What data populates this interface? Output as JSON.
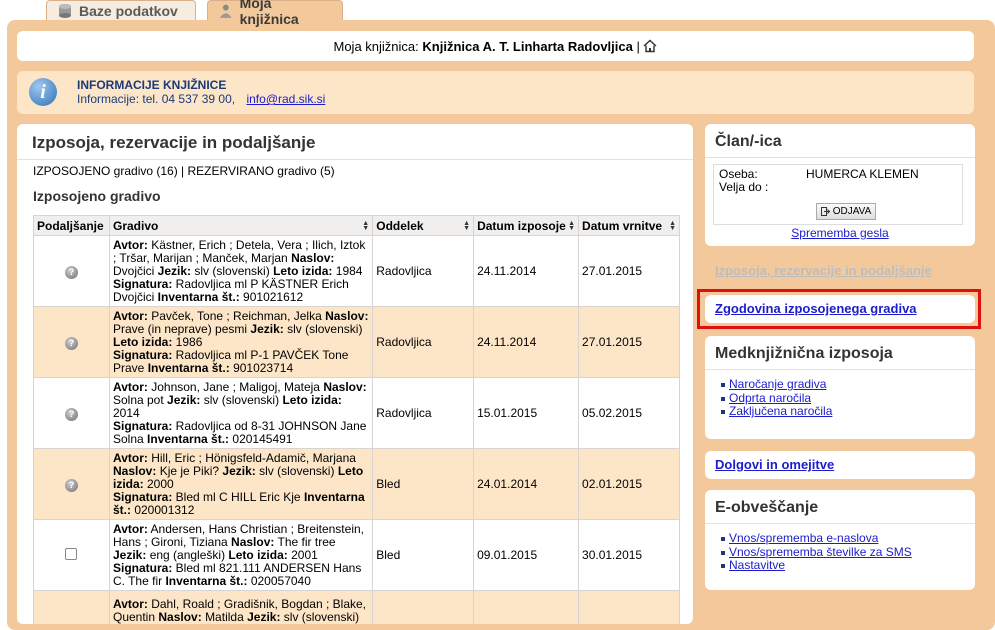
{
  "tabs": [
    {
      "label": "Baze podatkov",
      "icon": "database-icon"
    },
    {
      "label": "Moja knjižnica",
      "icon": "user-icon"
    }
  ],
  "library": {
    "prefix": "Moja knjižnica:",
    "name": "Knjižnica A. T. Linharta Radovljica",
    "separator": "|"
  },
  "info": {
    "title": "INFORMACIJE KNJIŽNICE",
    "label": "Informacije:",
    "phone": "tel. 04 537 39 00,",
    "email": "info@rad.sik.si"
  },
  "main": {
    "title": "Izposoja, rezervacije in podaljšanje",
    "summary": "IZPOSOJENO gradivo (16) | REZERVIRANO gradivo (5)",
    "subtitle": "Izposojeno gradivo",
    "columns": [
      "Podaljšanje",
      "Gradivo",
      "Oddelek",
      "Datum izposoje",
      "Datum vrnitve"
    ],
    "rows": [
      {
        "renew": "help",
        "avtor": "Kästner, Erich ; Detela, Vera ; Ilich, Iztok ; Tršar, Marijan ; Manček, Marjan",
        "naslov": "Dvojčici",
        "jezik": "slv (slovenski)",
        "leto": "1984",
        "signatura": "Radovljica ml P KÄSTNER Erich Dvojčici",
        "inventar": "901021612",
        "oddelek": "Radovljica",
        "izposoja": "24.11.2014",
        "vrnitev": "27.01.2015"
      },
      {
        "renew": "help",
        "avtor": "Pavček, Tone ; Reichman, Jelka",
        "naslov": "Prave (in neprave) pesmi",
        "jezik": "slv (slovenski)",
        "leto": "1986",
        "signatura": "Radovljica ml P-1 PAVČEK Tone Prave",
        "inventar": "901023714",
        "oddelek": "Radovljica",
        "izposoja": "24.11.2014",
        "vrnitev": "27.01.2015"
      },
      {
        "renew": "help",
        "avtor": "Johnson, Jane ; Maligoj, Mateja",
        "naslov": "Solna pot",
        "jezik": "slv (slovenski)",
        "leto": "2014",
        "signatura": "Radovljica od 8-31 JOHNSON Jane Solna",
        "inventar": "020145491",
        "oddelek": "Radovljica",
        "izposoja": "15.01.2015",
        "vrnitev": "05.02.2015"
      },
      {
        "renew": "help",
        "avtor": "Hill, Eric ; Hönigsfeld-Adamič, Marjana",
        "naslov": "Kje je Piki?",
        "jezik": "slv (slovenski)",
        "leto": "2000",
        "signatura": "Bled ml C HILL Eric Kje",
        "inventar": "020001312",
        "oddelek": "Bled",
        "izposoja": "24.01.2014",
        "vrnitev": "02.01.2015"
      },
      {
        "renew": "checkbox",
        "avtor": "Andersen, Hans Christian ; Breitenstein, Hans ; Gironi, Tiziana",
        "naslov": "The fir tree",
        "jezik": "eng (angleški)",
        "leto": "2001",
        "signatura": "Bled ml 821.111 ANDERSEN Hans C. The fir",
        "inventar": "020057040",
        "oddelek": "Bled",
        "izposoja": "09.01.2015",
        "vrnitev": "30.01.2015"
      },
      {
        "renew": "none",
        "avtor": "Dahl, Roald ; Gradišnik, Bogdan ; Blake, Quentin",
        "naslov": "Matilda",
        "jezik": "slv (slovenski)",
        "leto": "",
        "signatura": "",
        "inventar": "",
        "oddelek": "",
        "izposoja": "",
        "vrnitev": ""
      }
    ],
    "labels": {
      "avtor": "Avtor:",
      "naslov": "Naslov:",
      "jezik": "Jezik:",
      "leto": "Leto izida:",
      "signatura": "Signatura:",
      "inventar": "Inventarna št.:"
    }
  },
  "member": {
    "title": "Član/-ica",
    "person_label": "Oseba:",
    "person_value": "HUMERCA KLEMEN",
    "valid_label": "Velja do :",
    "logout": "ODJAVA",
    "password_change": "Sprememba gesla"
  },
  "sidebar": {
    "loans_link": "Izposoja, rezervacije in podaljšanje",
    "history_link": "Zgodovina izposojenega gradiva",
    "ill_title": "Medknjižnična izposoja",
    "ill_items": [
      "Naročanje gradiva",
      "Odprta naročila",
      "Zaključena naročila"
    ],
    "debts_link": "Dolgovi in omejitve",
    "enotify_title": "E-obveščanje",
    "enotify_items": [
      "Vnos/sprememba e-naslova",
      "Vnos/sprememba številke za SMS",
      "Nastavitve"
    ]
  },
  "colors": {
    "frame": "#f3c99c",
    "row_alt": "#fde6c8",
    "link": "#1c1ccc",
    "highlight": "#e01010"
  }
}
